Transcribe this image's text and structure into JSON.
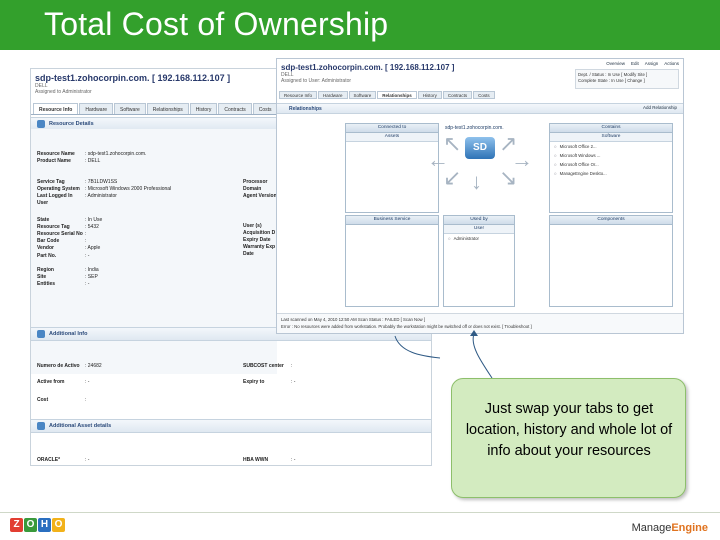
{
  "slide": {
    "title": "Total Cost of Ownership",
    "callout_text": "Just swap your tabs to get location, history and whole lot of info about your resources"
  },
  "left_screenshot": {
    "title": "sdp-test1.zohocorpin.com. [ 192.168.112.107 ]",
    "sub1": "DELL",
    "sub2": "Assigned to Administrator",
    "tabs": [
      "Resource Info",
      "Hardware",
      "Software",
      "Relationships",
      "History",
      "Contracts",
      "Costs"
    ],
    "section_resource_details": "Resource Details",
    "fields_left": [
      {
        "k": "Resource Name",
        "v": ": sdp-test1.zohocorpin.com."
      },
      {
        "k": "Product Name",
        "v": ": DELL"
      },
      {
        "k": "Service Tag",
        "v": ": 7B1LDW1SS"
      },
      {
        "k": "Operating System",
        "v": ": Microsoft Windows 2000 Professional"
      },
      {
        "k": "Last Logged In",
        "v": ": Administrator"
      },
      {
        "k": "User",
        "v": ""
      },
      {
        "k": "State",
        "v": ": In Use"
      },
      {
        "k": "Resource Tag",
        "v": ": 5432"
      },
      {
        "k": "Resource Serial No",
        "v": ":"
      },
      {
        "k": "Bar Code",
        "v": ":"
      },
      {
        "k": "Vendor",
        "v": ": Apple"
      },
      {
        "k": "Part No.",
        "v": ": -"
      },
      {
        "k": "Region",
        "v": ": India"
      },
      {
        "k": "Site",
        "v": ": SEP"
      },
      {
        "k": "Entities",
        "v": ": -"
      }
    ],
    "fields_right": [
      {
        "k": "Processor",
        "v": ""
      },
      {
        "k": "Domain",
        "v": ""
      },
      {
        "k": "Agent Version",
        "v": ""
      },
      {
        "k": "User (s)",
        "v": ""
      },
      {
        "k": "Acquisition D",
        "v": ""
      },
      {
        "k": "Expiry Date",
        "v": ""
      },
      {
        "k": "Warranty Exp",
        "v": ""
      },
      {
        "k": "Date",
        "v": ""
      }
    ],
    "section_additional_info": "Additional Info",
    "additional_info": [
      {
        "k": "Numero de Activo",
        "v": ": 24682",
        "k2": "SUBCOST center",
        "v2": ":"
      },
      {
        "k": "Active from",
        "v": ": -",
        "k2": "Expiry to",
        "v2": ": -"
      },
      {
        "k": "Cost",
        "v": ":",
        "k2": "",
        "v2": ""
      }
    ],
    "section_additional_asset": "Additional Asset details",
    "asset_details": [
      {
        "k": "ORACLE*",
        "v": ": -",
        "k2": "HBA WWN",
        "v2": ": -"
      }
    ]
  },
  "right_screenshot": {
    "title": "sdp-test1.zohocorpin.com. [ 192.168.112.107 ]",
    "sub1": "DELL",
    "sub2": "Assigned to User: Administrator",
    "topnav": [
      "Overview",
      "Edit",
      "Assign",
      "Actions"
    ],
    "infobox_line1": "Dept. / Status : In Use  [ Modify Site ]",
    "infobox_line2": "Complete State : In Use  [ Change ]",
    "tabs": [
      "Resource Info",
      "Hardware",
      "Software",
      "Relationships",
      "History",
      "Contracts",
      "Costs"
    ],
    "band_title": "Relationships",
    "add_relationship": "Add Relationship",
    "center_host": "sdp-test1.zohocorpin.com.",
    "center_icon_text": "SD",
    "connected_to": "Connected to",
    "assets": "Assets",
    "contains": "Contains",
    "software": "Software",
    "software_items": [
      "Microsoft Office 2...",
      "Microsoft Windows ...",
      "Microsoft Office Or...",
      "ManageEngine Deskto..."
    ],
    "business_service": "Business Service",
    "used_by": "Used by",
    "user": "User",
    "user_items": [
      "Administrator"
    ],
    "components": "Components",
    "foot_line1": "Last scanned on May 4, 2010 12:50 AM  Scan Status : FAILED  [ Scan Now ]",
    "foot_line2": "Error : No resources were added from workstation. Probably the workstation might be switched off or does not exist.  [ Troubleshoot ]"
  },
  "footer": {
    "zoho_letters": [
      "Z",
      "O",
      "H",
      "O"
    ],
    "zoho_colors": [
      "#e23e32",
      "#3a9a3c",
      "#2a6fc0",
      "#f2b21a"
    ],
    "manage_engine_part1": "Manage",
    "manage_engine_part2": "Engine"
  },
  "colors": {
    "title_bar": "#33a02c",
    "callout_fill": "#d3ebc0",
    "callout_border": "#8dbf6b",
    "connector_line": "#2f5a85"
  }
}
